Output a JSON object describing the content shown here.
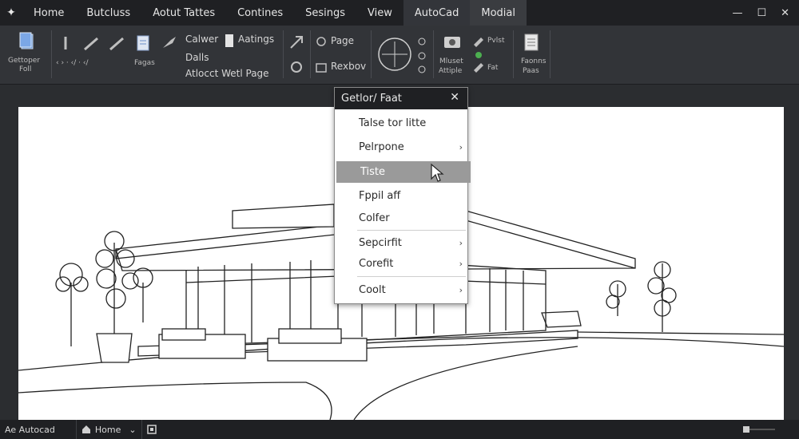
{
  "tabs": [
    "Home",
    "Butcluss",
    "Aotut Tattes",
    "Contines",
    "Sesings",
    "View",
    "AutoCad",
    "Modial"
  ],
  "window": {
    "minimize": "—",
    "maximize": "☐",
    "close": "✕"
  },
  "ribbon": {
    "group1": {
      "label_line1": "Gettoper",
      "label_line2": "Foll"
    },
    "group2": {
      "small": "‹ › · ‹/ · ‹/",
      "label": "Fagas"
    },
    "group3": {
      "item1": "Calwer",
      "item2": "Dalls",
      "item3": "Atlocct Wetl Page",
      "item4": "Aatings"
    },
    "group4": {
      "item1": "Page",
      "item2": "Rexbov"
    },
    "group6": {
      "label_line1": "Mluset",
      "label_line2": "Attiple"
    },
    "group7": {
      "item1": "Pvlst",
      "item2": "Fat"
    },
    "group8": {
      "label_line1": "Faonns",
      "label_line2": "Paas"
    }
  },
  "panel": {
    "title": "Getlor/ Faat",
    "close": "✕",
    "items": [
      {
        "label": "Talse tor litte",
        "submenu": false
      },
      {
        "label": "Pelrpone",
        "submenu": true
      },
      {
        "label": "Tiste",
        "submenu": false,
        "selected": true
      },
      {
        "label": "Fppil aff",
        "submenu": false
      },
      {
        "label": "Colfer",
        "submenu": false
      },
      {
        "label": "Sepcirfit",
        "submenu": true
      },
      {
        "label": "Corefit",
        "submenu": true
      },
      {
        "label": "Coolt",
        "submenu": true
      }
    ],
    "submenu_glyph": "›"
  },
  "statusbar": {
    "item1": "Ae Autocad",
    "item2": "Home",
    "caret": "⌄"
  },
  "colors": {
    "titlebar": "#1f2023",
    "ribbon": "#323438",
    "selected_item": "#9a9a9a"
  }
}
